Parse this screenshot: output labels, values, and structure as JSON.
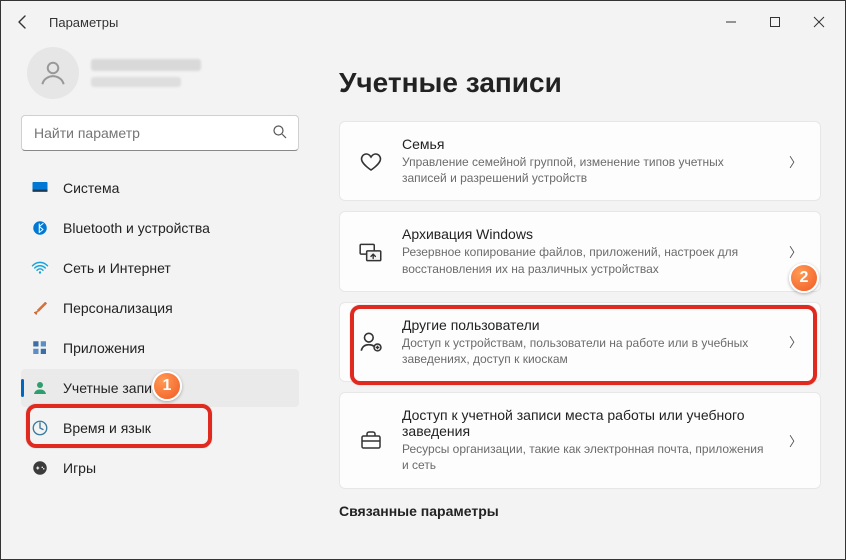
{
  "window": {
    "title": "Параметры"
  },
  "search": {
    "placeholder": "Найти параметр"
  },
  "sidebar": {
    "items": [
      {
        "label": "Система"
      },
      {
        "label": "Bluetooth и устройства"
      },
      {
        "label": "Сеть и Интернет"
      },
      {
        "label": "Персонализация"
      },
      {
        "label": "Приложения"
      },
      {
        "label": "Учетные записи"
      },
      {
        "label": "Время и язык"
      },
      {
        "label": "Игры"
      }
    ]
  },
  "page": {
    "title": "Учетные записи"
  },
  "cards": [
    {
      "title": "Семья",
      "desc": "Управление семейной группой, изменение типов учетных записей и разрешений устройств"
    },
    {
      "title": "Архивация Windows",
      "desc": "Резервное копирование файлов, приложений, настроек для восстановления их на различных устройствах"
    },
    {
      "title": "Другие пользователи",
      "desc": "Доступ к устройствам, пользователи на работе или в учебных заведениях, доступ к киоскам"
    },
    {
      "title": "Доступ к учетной записи места работы или учебного заведения",
      "desc": "Ресурсы организации, такие как электронная почта, приложения и сеть"
    }
  ],
  "related": {
    "header": "Связанные параметры"
  },
  "steps": {
    "s1": "1",
    "s2": "2"
  }
}
